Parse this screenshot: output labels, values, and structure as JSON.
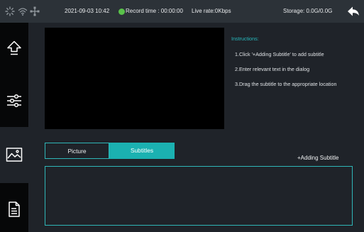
{
  "statusbar": {
    "datetime": "2021-09-03 10:42",
    "record_time": "Record time : 00:00:00",
    "live_rate": "Live rate:0Kbps",
    "storage": "Storage: 0.0G/0.0G",
    "icons": [
      "loading-icon",
      "wifi-icon",
      "network-icon",
      "record-status-icon",
      "back-icon"
    ],
    "record_color": "#59c24a"
  },
  "sidebar": {
    "items": [
      {
        "icon": "upload-icon"
      },
      {
        "icon": "sliders-icon"
      },
      {
        "icon": "image-icon",
        "active": true
      },
      {
        "icon": "document-icon"
      }
    ]
  },
  "instructions": {
    "title": "Instructions:",
    "lines": [
      "1.Click '+Adding Subtitle' to add subtitle",
      "2.Enter relevant text in the dialog",
      "3.Drag the subtitle to the appropriate location"
    ]
  },
  "tabs": [
    {
      "label": "Picture",
      "selected": false
    },
    {
      "label": "Subtitles",
      "selected": true
    }
  ],
  "add_subtitle_label": "+Adding Subtitle",
  "colors": {
    "accent": "#1bb1b1",
    "background": "#1f2329",
    "topbar": "#2c3238"
  }
}
